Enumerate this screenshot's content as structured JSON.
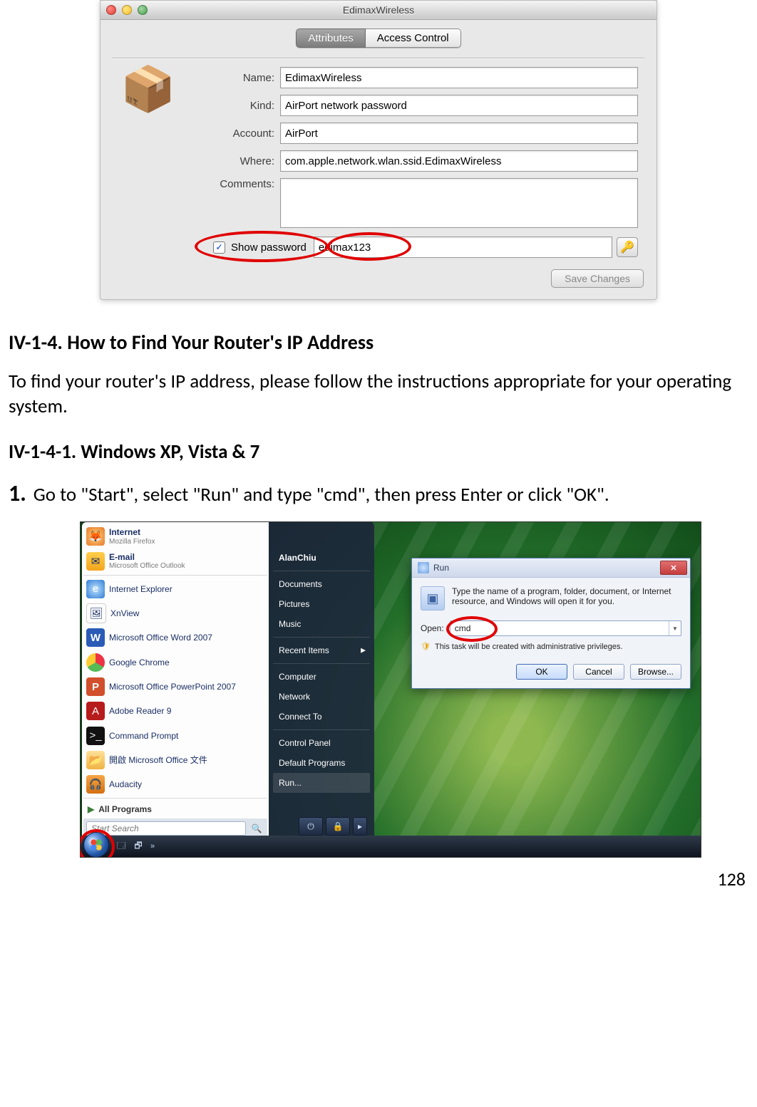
{
  "mac": {
    "title": "EdimaxWireless",
    "tabs": {
      "attributes": "Attributes",
      "access_control": "Access Control"
    },
    "labels": {
      "name": "Name:",
      "kind": "Kind:",
      "account": "Account:",
      "where": "Where:",
      "comments": "Comments:"
    },
    "values": {
      "name": "EdimaxWireless",
      "kind": "AirPort network password",
      "account": "AirPort",
      "where": "com.apple.network.wlan.ssid.EdimaxWireless",
      "comments": ""
    },
    "show_password_label": "Show password",
    "password": "edimax123",
    "save_button": "Save Changes",
    "app_icon": "📦"
  },
  "doc": {
    "heading_main": "IV-1-4. How to Find Your Router's IP Address",
    "intro": "To find your router's IP address, please follow the instructions appropriate for your operating system.",
    "heading_sub": "IV-1-4-1.    Windows XP, Vista & 7",
    "step1_num": "1.",
    "step1_text": "Go to \"Start\", select \"Run\" and type \"cmd\", then press Enter or click \"OK\"."
  },
  "vista": {
    "start_left": {
      "internet": {
        "label": "Internet",
        "sub": "Mozilla Firefox"
      },
      "email": {
        "label": "E-mail",
        "sub": "Microsoft Office Outlook"
      },
      "items": [
        "Internet Explorer",
        "XnView",
        "Microsoft Office Word 2007",
        "Google Chrome",
        "Microsoft Office PowerPoint 2007",
        "Adobe Reader 9",
        "Command Prompt",
        "開啟 Microsoft Office 文件",
        "Audacity"
      ],
      "all_programs": "All Programs",
      "search_placeholder": "Start Search"
    },
    "start_right": [
      "AlanChiu",
      "Documents",
      "Pictures",
      "Music",
      "Recent Items",
      "Computer",
      "Network",
      "Connect To",
      "Control Panel",
      "Default Programs",
      "Run..."
    ],
    "run": {
      "title": "Run",
      "message": "Type the name of a program, folder, document, or Internet resource, and Windows will open it for you.",
      "open_label": "Open:",
      "value": "cmd",
      "priv_msg": "This task will be created with administrative privileges.",
      "ok": "OK",
      "cancel": "Cancel",
      "browse": "Browse..."
    }
  },
  "page_number": "128"
}
